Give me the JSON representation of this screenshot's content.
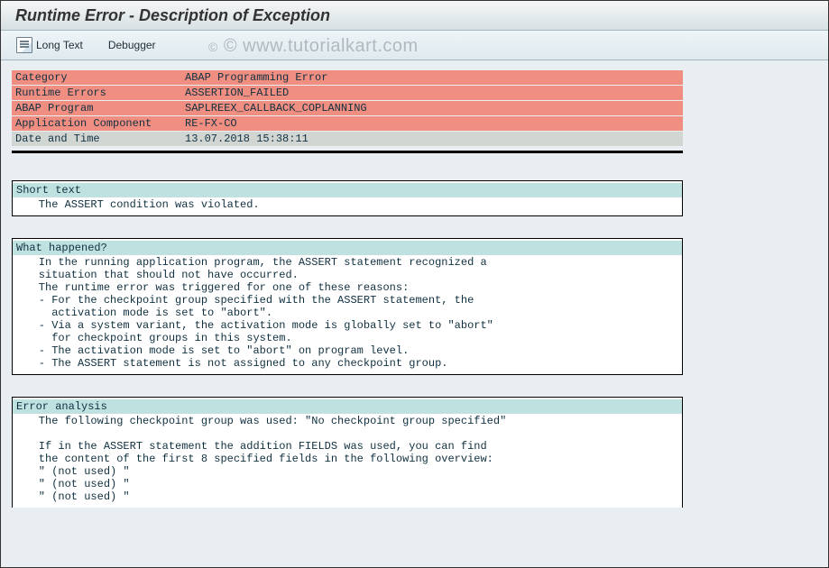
{
  "window": {
    "title": "Runtime Error - Description of Exception"
  },
  "toolbar": {
    "long_text_label": "Long Text",
    "debugger_label": "Debugger"
  },
  "info_rows": [
    {
      "label": "Category",
      "value": "ABAP Programming Error",
      "style": "red"
    },
    {
      "label": "Runtime Errors",
      "value": "ASSERTION_FAILED",
      "style": "red"
    },
    {
      "label": "ABAP Program",
      "value": "SAPLREEX_CALLBACK_COPLANNING",
      "style": "red"
    },
    {
      "label": "Application Component",
      "value": "RE-FX-CO",
      "style": "red"
    },
    {
      "label": "Date and Time",
      "value": "13.07.2018 15:38:11",
      "style": "grey"
    }
  ],
  "sections": {
    "short_text": {
      "heading": "Short text",
      "body": "    The ASSERT condition was violated."
    },
    "what_happened": {
      "heading": "What happened?",
      "body": "    In the running application program, the ASSERT statement recognized a\n    situation that should not have occurred.\n    The runtime error was triggered for one of these reasons:\n    - For the checkpoint group specified with the ASSERT statement, the\n      activation mode is set to \"abort\".\n    - Via a system variant, the activation mode is globally set to \"abort\"\n      for checkpoint groups in this system.\n    - The activation mode is set to \"abort\" on program level.\n    - The ASSERT statement is not assigned to any checkpoint group."
    },
    "error_analysis": {
      "heading": "Error analysis",
      "body": "    The following checkpoint group was used: \"No checkpoint group specified\"\n\n    If in the ASSERT statement the addition FIELDS was used, you can find\n    the content of the first 8 specified fields in the following overview:\n    \" (not used) \"\n    \" (not used) \"\n    \" (not used) \""
    }
  },
  "watermark": {
    "text": "© www.tutorialkart.com"
  }
}
